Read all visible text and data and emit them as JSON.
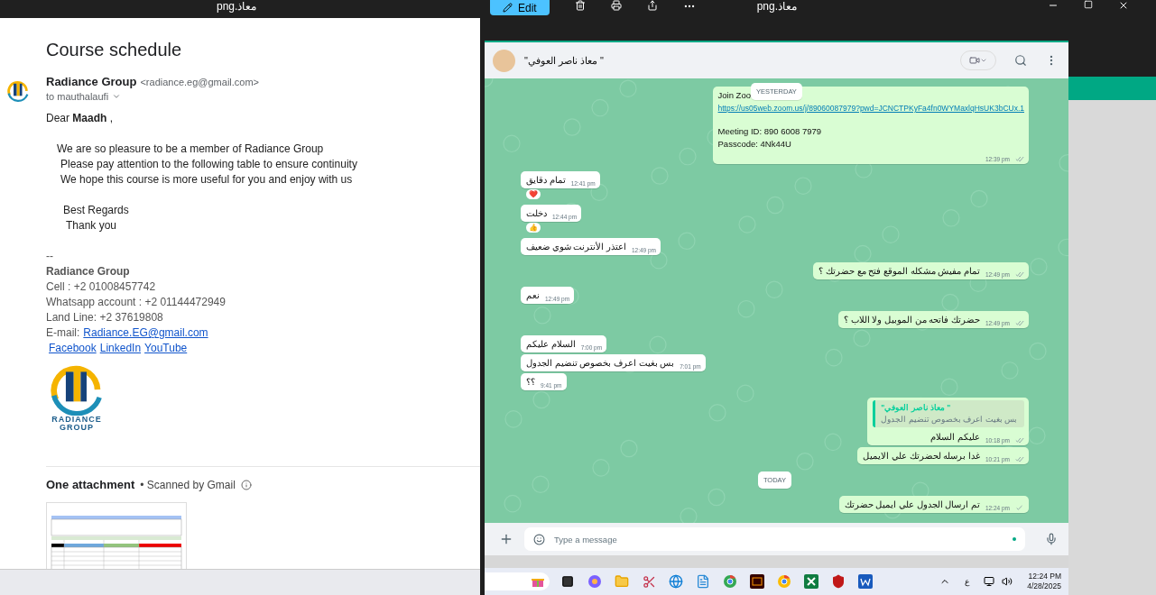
{
  "left_viewer": {
    "file_name": "png.معاذ"
  },
  "email": {
    "subject": "Course schedule",
    "sender_name": "Radiance Group",
    "sender_address": "<radiance.eg@gmail.com>",
    "recipient": "to mauthalaufi",
    "greeting": "Dear **Maadh** ,",
    "body_lines": [
      "We are so pleasure to be a member of Radiance Group",
      "Please pay attention to the following table to ensure continuity",
      "We hope this course is more useful for you and enjoy with us"
    ],
    "closing_lines": [
      "Best Regards",
      "Thank you"
    ],
    "signature_separator": "--",
    "signature": {
      "company": "Radiance Group",
      "lines": [
        "Cell : +2 01008457742",
        "Whatsapp account : +2 01144472949",
        "Land Line: +2 37619808"
      ],
      "email_label": "E-mail:",
      "email_link": "Radiance.EG@gmail.com",
      "links": [
        "Facebook",
        "LinkedIn",
        "YouTube "
      ],
      "logo_text": [
        "RADIANCE",
        "GROUP"
      ]
    },
    "attachments_title": "One attachment",
    "scan_note": "• Scanned by Gmail"
  },
  "right_viewer": {
    "edit_label": "Edit",
    "file_name": "png.معاذ"
  },
  "chat": {
    "contact_name": "\"معاذ ناصر العوفي \"",
    "floating_date": "YESTERDAY",
    "input_placeholder": "Type a message",
    "messages": [
      {
        "kind": "outgoing",
        "lines": [
          "Join Zoo"
        ],
        "link": "https://us05web.zoom.us/j/89060087979?pwd=JCNCTPKyFa4fn0WYMaxlqHsUK3bCUx.1",
        "extra_lines": [
          "Meeting ID: 890 6008 7979",
          "Passcode: 4Nk44U"
        ],
        "time": "12:39 pm",
        "delivered": true
      },
      {
        "kind": "incoming",
        "lines": [
          "تمام دقايق"
        ],
        "time": "12:41 pm",
        "reaction": "❤️"
      },
      {
        "kind": "incoming",
        "lines": [
          "دخلت"
        ],
        "time": "12:44 pm",
        "reaction": "👍"
      },
      {
        "kind": "incoming",
        "lines": [
          "اعتذر الأنترنت شوي ضعيف"
        ],
        "time": "12:49 pm"
      },
      {
        "kind": "outgoing",
        "lines": [
          "تمام مفيش مشكله الموقع فتح مع حضرتك ؟"
        ],
        "time": "12:49 pm",
        "delivered": true
      },
      {
        "kind": "incoming",
        "lines": [
          "نعم"
        ],
        "time": "12:49 pm"
      },
      {
        "kind": "outgoing",
        "lines": [
          "حضرتك فاتحه من الموبيل ولا اللاب ؟"
        ],
        "time": "12:49 pm",
        "delivered": true
      },
      {
        "kind": "incoming",
        "lines": [
          "السلام عليكم"
        ],
        "time": "7:00 pm"
      },
      {
        "kind": "incoming",
        "lines": [
          "بس بغيت اعرف بخصوص تنضيم الجدول"
        ],
        "time": "7:01 pm"
      },
      {
        "kind": "incoming",
        "lines": [
          "؟؟"
        ],
        "time": "9:41 pm"
      },
      {
        "kind": "outgoing",
        "quote": {
          "author": "\"معاذ ناصر العوفي \"",
          "text": "بس بغيت اعرف بخصوص تنضيم الجدول"
        },
        "lines": [
          "عليكم السلام"
        ],
        "time": "10:18 pm",
        "delivered": true
      },
      {
        "kind": "outgoing",
        "lines": [
          "غدا برسله لحضرتك علي الايميل"
        ],
        "time": "10:21 pm",
        "delivered": true
      },
      {
        "kind": "date",
        "label": "TODAY"
      },
      {
        "kind": "outgoing",
        "lines": [
          "تم ارسال الجدول علي ايميل حضرتك"
        ],
        "time": "12:24 pm",
        "delivered": false
      }
    ]
  },
  "taskbar": {
    "language": "ع",
    "time": "12:24 PM",
    "date": "4/28/2025"
  }
}
